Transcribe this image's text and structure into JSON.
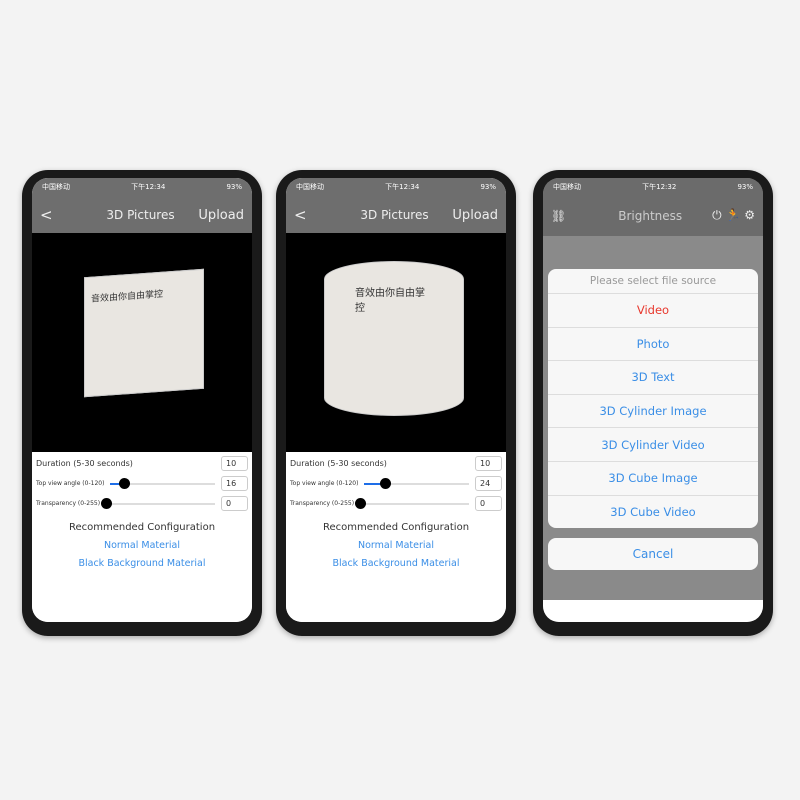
{
  "phones": [
    {
      "status": {
        "carrier": "中国移动",
        "time": "下午12:34",
        "battery": "93%"
      },
      "nav": {
        "back": "<",
        "title": "3D Pictures",
        "action": "Upload"
      },
      "product_text": "音效由你自由掌控",
      "settings": {
        "duration_label": "Duration (5-30 seconds)",
        "duration": "10",
        "angle_label": "Top view angle (0-120)",
        "angle": "16",
        "angle_pct": 13,
        "transparency_label": "Transparency (0-255)",
        "transparency": "0",
        "transparency_pct": 0
      },
      "config": {
        "title": "Recommended Configuration",
        "normal": "Normal Material",
        "black": "Black Background Material"
      }
    },
    {
      "status": {
        "carrier": "中国移动",
        "time": "下午12:34",
        "battery": "93%"
      },
      "nav": {
        "back": "<",
        "title": "3D Pictures",
        "action": "Upload"
      },
      "product_text": "音效由你自由掌控",
      "settings": {
        "duration_label": "Duration (5-30 seconds)",
        "duration": "10",
        "angle_label": "Top view angle (0-120)",
        "angle": "24",
        "angle_pct": 20,
        "transparency_label": "Transparency (0-255)",
        "transparency": "0",
        "transparency_pct": 0
      },
      "config": {
        "title": "Recommended Configuration",
        "normal": "Normal Material",
        "black": "Black Background Material"
      }
    }
  ],
  "phone3": {
    "status": {
      "carrier": "中国移动",
      "time": "下午12:32",
      "battery": "93%"
    },
    "title": "Brightness",
    "icons": [
      "unlink-icon",
      "power-icon",
      "running-icon",
      "gear-icon"
    ],
    "sheet": {
      "header": "Please select file source",
      "options": [
        "Video",
        "Photo",
        "3D Text",
        "3D Cylinder Image",
        "3D Cylinder Video",
        "3D Cube Image",
        "3D Cube Video"
      ],
      "cancel": "Cancel"
    },
    "colors": {
      "accent": "#3a8ee6",
      "danger": "#e8372c"
    }
  }
}
